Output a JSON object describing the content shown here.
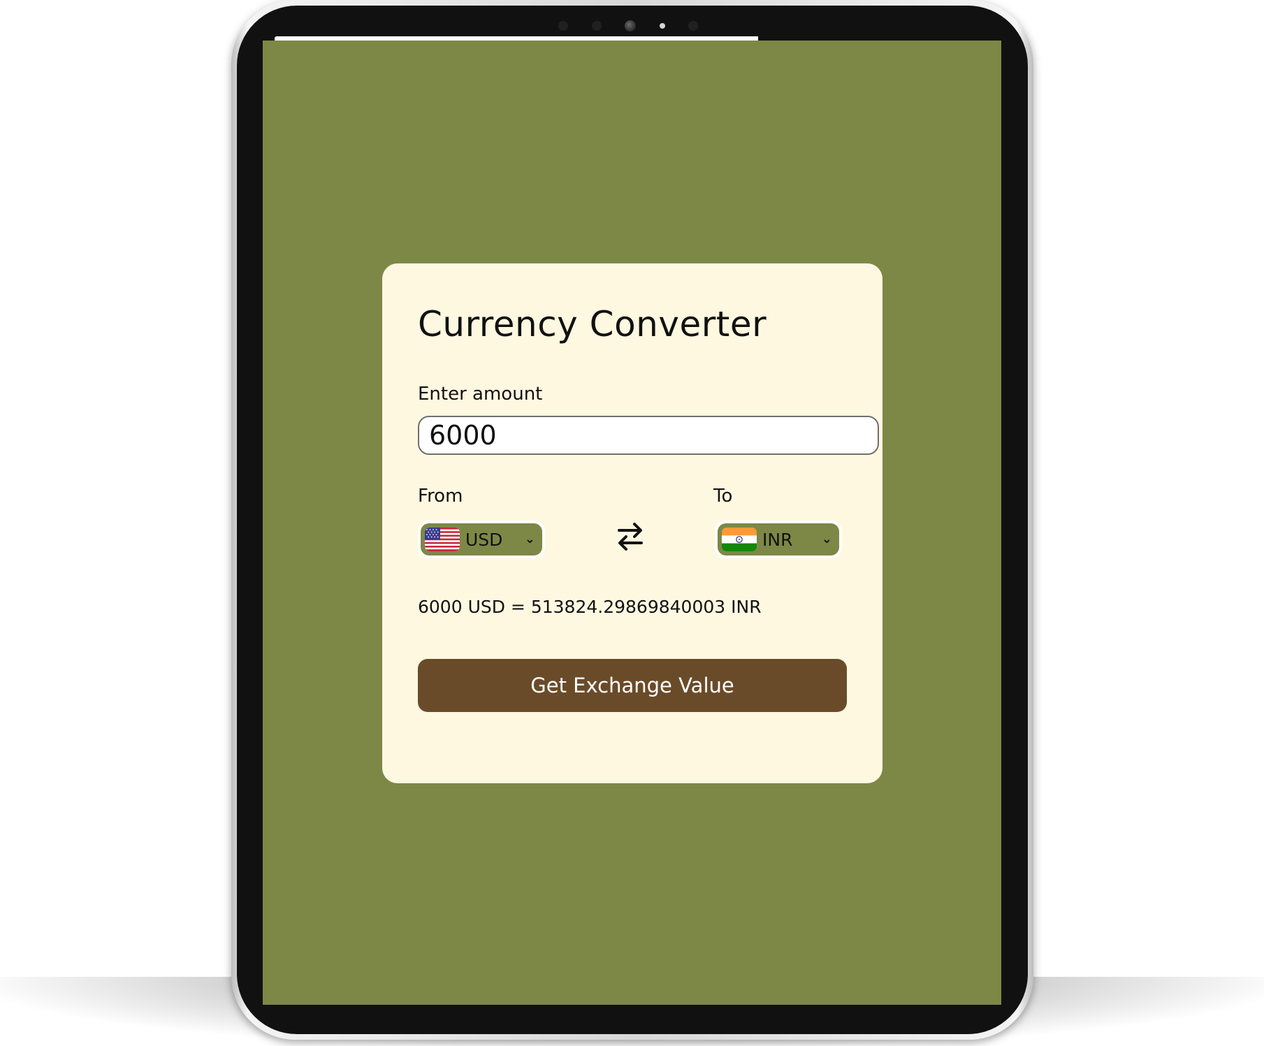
{
  "colors": {
    "background": "#7d8846",
    "card": "#fff8e1",
    "button": "#6a4b29",
    "button_text": "#ffffff"
  },
  "converter": {
    "title": "Currency Converter",
    "amount_label": "Enter amount",
    "amount_value": "6000",
    "from_label": "From",
    "from_currency": "USD",
    "from_flag": "us-flag-icon",
    "to_label": "To",
    "to_currency": "INR",
    "to_flag": "india-flag-icon",
    "swap_icon": "swap-arrows-icon",
    "result_text": "6000 USD = 513824.29869840003 INR",
    "button_label": "Get Exchange Value"
  }
}
